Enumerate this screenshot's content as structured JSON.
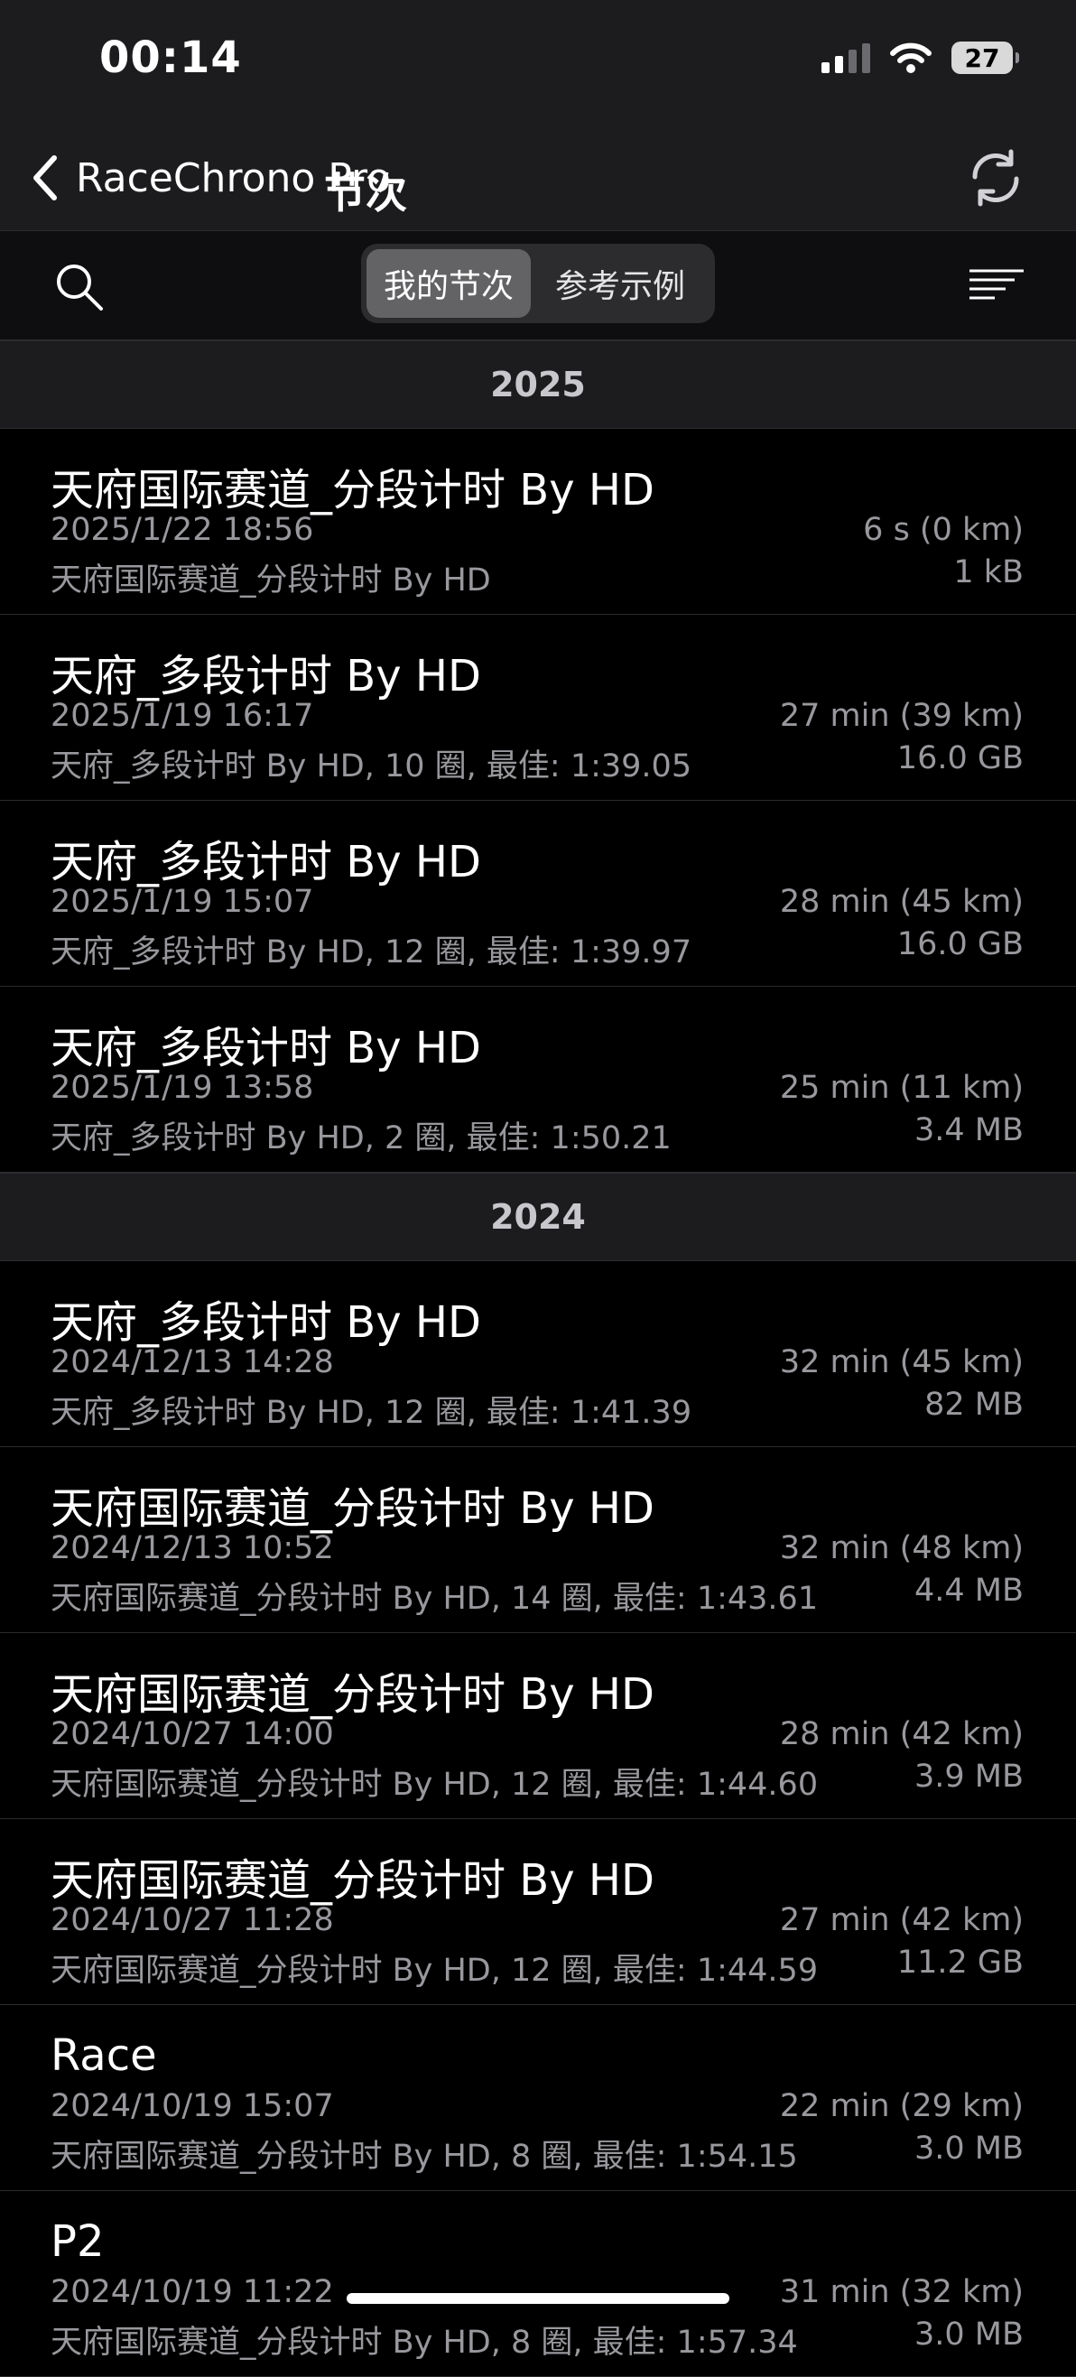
{
  "status_bar": {
    "time": "00:14",
    "battery": "27"
  },
  "nav": {
    "back_label": "RaceChrono Pro",
    "title": "节次"
  },
  "toolbar": {
    "segments": [
      "我的节次",
      "参考示例"
    ]
  },
  "sections": [
    {
      "year": "2025",
      "sessions": [
        {
          "title": "天府国际赛道_分段计时 By HD",
          "date": "2025/1/22 18:56",
          "desc": "天府国际赛道_分段计时 By HD",
          "duration": "6 s (0 km)",
          "size": "1 kB"
        },
        {
          "title": "天府_多段计时 By HD",
          "date": "2025/1/19 16:17",
          "desc": "天府_多段计时 By HD, 10 圈, 最佳: 1:39.05",
          "duration": "27 min (39 km)",
          "size": "16.0 GB"
        },
        {
          "title": "天府_多段计时 By HD",
          "date": "2025/1/19 15:07",
          "desc": "天府_多段计时 By HD, 12 圈, 最佳: 1:39.97",
          "duration": "28 min (45 km)",
          "size": "16.0 GB"
        },
        {
          "title": "天府_多段计时 By HD",
          "date": "2025/1/19 13:58",
          "desc": "天府_多段计时 By HD, 2 圈, 最佳: 1:50.21",
          "duration": "25 min (11 km)",
          "size": "3.4 MB"
        }
      ]
    },
    {
      "year": "2024",
      "sessions": [
        {
          "title": "天府_多段计时 By HD",
          "date": "2024/12/13 14:28",
          "desc": "天府_多段计时 By HD, 12 圈, 最佳: 1:41.39",
          "duration": "32 min (45 km)",
          "size": "82 MB"
        },
        {
          "title": "天府国际赛道_分段计时 By HD",
          "date": "2024/12/13 10:52",
          "desc": "天府国际赛道_分段计时 By HD, 14 圈, 最佳: 1:43.61",
          "duration": "32 min (48 km)",
          "size": "4.4 MB"
        },
        {
          "title": "天府国际赛道_分段计时 By HD",
          "date": "2024/10/27 14:00",
          "desc": "天府国际赛道_分段计时 By HD, 12 圈, 最佳: 1:44.60",
          "duration": "28 min (42 km)",
          "size": "3.9 MB"
        },
        {
          "title": "天府国际赛道_分段计时 By HD",
          "date": "2024/10/27 11:28",
          "desc": "天府国际赛道_分段计时 By HD, 12 圈, 最佳: 1:44.59",
          "duration": "27 min (42 km)",
          "size": "11.2 GB"
        },
        {
          "title": "Race",
          "date": "2024/10/19 15:07",
          "desc": "天府国际赛道_分段计时 By HD, 8 圈, 最佳: 1:54.15",
          "duration": "22 min (29 km)",
          "size": "3.0 MB"
        },
        {
          "title": "P2",
          "date": "2024/10/19 11:22",
          "desc": "天府国际赛道_分段计时 By HD, 8 圈, 最佳: 1:57.34",
          "duration": "31 min (32 km)",
          "size": "3.0 MB"
        }
      ]
    }
  ]
}
